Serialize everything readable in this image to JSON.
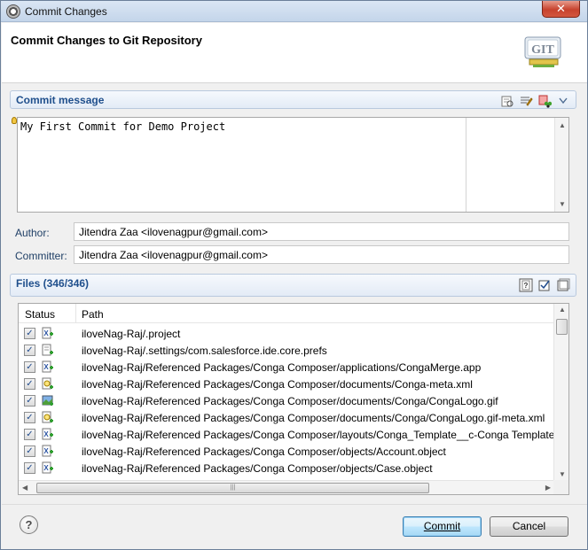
{
  "window": {
    "title": "Commit Changes",
    "close_label": "✕"
  },
  "header": {
    "title": "Commit Changes to Git Repository",
    "logo_text": "GIT"
  },
  "commit_section": {
    "title": "Commit message",
    "message": "My First Commit for Demo Project"
  },
  "author": {
    "label": "Author:",
    "value": "Jitendra Zaa <ilovenagpur@gmail.com>"
  },
  "committer": {
    "label": "Committer:",
    "value": "Jitendra Zaa <ilovenagpur@gmail.com>"
  },
  "files_section": {
    "title": "Files (346/346)",
    "columns": [
      "Status",
      "Path"
    ],
    "rows": [
      {
        "path": "iloveNag-Raj/.project",
        "icon": "xml-file-icon"
      },
      {
        "path": "iloveNag-Raj/.settings/com.salesforce.ide.core.prefs",
        "icon": "text-file-icon"
      },
      {
        "path": "iloveNag-Raj/Referenced Packages/Conga Composer/applications/CongaMerge.app",
        "icon": "xml-file-icon"
      },
      {
        "path": "iloveNag-Raj/Referenced Packages/Conga Composer/documents/Conga-meta.xml",
        "icon": "search-file-icon"
      },
      {
        "path": "iloveNag-Raj/Referenced Packages/Conga Composer/documents/Conga/CongaLogo.gif",
        "icon": "image-file-icon"
      },
      {
        "path": "iloveNag-Raj/Referenced Packages/Conga Composer/documents/Conga/CongaLogo.gif-meta.xml",
        "icon": "search-file-icon"
      },
      {
        "path": "iloveNag-Raj/Referenced Packages/Conga Composer/layouts/Conga_Template__c-Conga Template",
        "icon": "xml-file-icon"
      },
      {
        "path": "iloveNag-Raj/Referenced Packages/Conga Composer/objects/Account.object",
        "icon": "xml-file-icon"
      },
      {
        "path": "iloveNag-Raj/Referenced Packages/Conga Composer/objects/Case.object",
        "icon": "xml-file-icon"
      }
    ]
  },
  "buttons": {
    "help": "?",
    "commit": "Commit",
    "cancel": "Cancel"
  }
}
